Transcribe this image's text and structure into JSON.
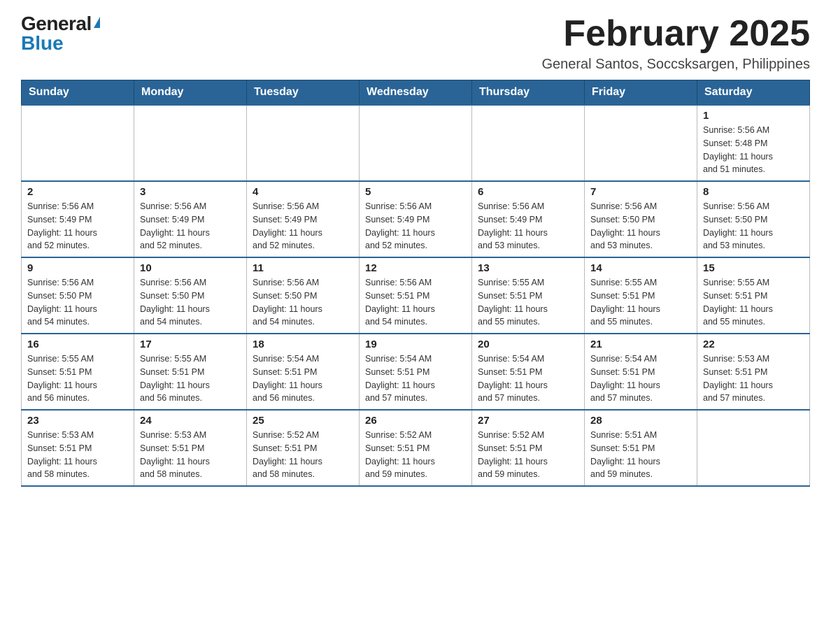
{
  "header": {
    "logo": {
      "general": "General",
      "blue": "Blue",
      "alt": "GeneralBlue logo"
    },
    "title": "February 2025",
    "subtitle": "General Santos, Soccsksargen, Philippines"
  },
  "calendar": {
    "days_of_week": [
      "Sunday",
      "Monday",
      "Tuesday",
      "Wednesday",
      "Thursday",
      "Friday",
      "Saturday"
    ],
    "weeks": [
      [
        {
          "day": "",
          "info": ""
        },
        {
          "day": "",
          "info": ""
        },
        {
          "day": "",
          "info": ""
        },
        {
          "day": "",
          "info": ""
        },
        {
          "day": "",
          "info": ""
        },
        {
          "day": "",
          "info": ""
        },
        {
          "day": "1",
          "info": "Sunrise: 5:56 AM\nSunset: 5:48 PM\nDaylight: 11 hours\nand 51 minutes."
        }
      ],
      [
        {
          "day": "2",
          "info": "Sunrise: 5:56 AM\nSunset: 5:49 PM\nDaylight: 11 hours\nand 52 minutes."
        },
        {
          "day": "3",
          "info": "Sunrise: 5:56 AM\nSunset: 5:49 PM\nDaylight: 11 hours\nand 52 minutes."
        },
        {
          "day": "4",
          "info": "Sunrise: 5:56 AM\nSunset: 5:49 PM\nDaylight: 11 hours\nand 52 minutes."
        },
        {
          "day": "5",
          "info": "Sunrise: 5:56 AM\nSunset: 5:49 PM\nDaylight: 11 hours\nand 52 minutes."
        },
        {
          "day": "6",
          "info": "Sunrise: 5:56 AM\nSunset: 5:49 PM\nDaylight: 11 hours\nand 53 minutes."
        },
        {
          "day": "7",
          "info": "Sunrise: 5:56 AM\nSunset: 5:50 PM\nDaylight: 11 hours\nand 53 minutes."
        },
        {
          "day": "8",
          "info": "Sunrise: 5:56 AM\nSunset: 5:50 PM\nDaylight: 11 hours\nand 53 minutes."
        }
      ],
      [
        {
          "day": "9",
          "info": "Sunrise: 5:56 AM\nSunset: 5:50 PM\nDaylight: 11 hours\nand 54 minutes."
        },
        {
          "day": "10",
          "info": "Sunrise: 5:56 AM\nSunset: 5:50 PM\nDaylight: 11 hours\nand 54 minutes."
        },
        {
          "day": "11",
          "info": "Sunrise: 5:56 AM\nSunset: 5:50 PM\nDaylight: 11 hours\nand 54 minutes."
        },
        {
          "day": "12",
          "info": "Sunrise: 5:56 AM\nSunset: 5:51 PM\nDaylight: 11 hours\nand 54 minutes."
        },
        {
          "day": "13",
          "info": "Sunrise: 5:55 AM\nSunset: 5:51 PM\nDaylight: 11 hours\nand 55 minutes."
        },
        {
          "day": "14",
          "info": "Sunrise: 5:55 AM\nSunset: 5:51 PM\nDaylight: 11 hours\nand 55 minutes."
        },
        {
          "day": "15",
          "info": "Sunrise: 5:55 AM\nSunset: 5:51 PM\nDaylight: 11 hours\nand 55 minutes."
        }
      ],
      [
        {
          "day": "16",
          "info": "Sunrise: 5:55 AM\nSunset: 5:51 PM\nDaylight: 11 hours\nand 56 minutes."
        },
        {
          "day": "17",
          "info": "Sunrise: 5:55 AM\nSunset: 5:51 PM\nDaylight: 11 hours\nand 56 minutes."
        },
        {
          "day": "18",
          "info": "Sunrise: 5:54 AM\nSunset: 5:51 PM\nDaylight: 11 hours\nand 56 minutes."
        },
        {
          "day": "19",
          "info": "Sunrise: 5:54 AM\nSunset: 5:51 PM\nDaylight: 11 hours\nand 57 minutes."
        },
        {
          "day": "20",
          "info": "Sunrise: 5:54 AM\nSunset: 5:51 PM\nDaylight: 11 hours\nand 57 minutes."
        },
        {
          "day": "21",
          "info": "Sunrise: 5:54 AM\nSunset: 5:51 PM\nDaylight: 11 hours\nand 57 minutes."
        },
        {
          "day": "22",
          "info": "Sunrise: 5:53 AM\nSunset: 5:51 PM\nDaylight: 11 hours\nand 57 minutes."
        }
      ],
      [
        {
          "day": "23",
          "info": "Sunrise: 5:53 AM\nSunset: 5:51 PM\nDaylight: 11 hours\nand 58 minutes."
        },
        {
          "day": "24",
          "info": "Sunrise: 5:53 AM\nSunset: 5:51 PM\nDaylight: 11 hours\nand 58 minutes."
        },
        {
          "day": "25",
          "info": "Sunrise: 5:52 AM\nSunset: 5:51 PM\nDaylight: 11 hours\nand 58 minutes."
        },
        {
          "day": "26",
          "info": "Sunrise: 5:52 AM\nSunset: 5:51 PM\nDaylight: 11 hours\nand 59 minutes."
        },
        {
          "day": "27",
          "info": "Sunrise: 5:52 AM\nSunset: 5:51 PM\nDaylight: 11 hours\nand 59 minutes."
        },
        {
          "day": "28",
          "info": "Sunrise: 5:51 AM\nSunset: 5:51 PM\nDaylight: 11 hours\nand 59 minutes."
        },
        {
          "day": "",
          "info": ""
        }
      ]
    ]
  }
}
